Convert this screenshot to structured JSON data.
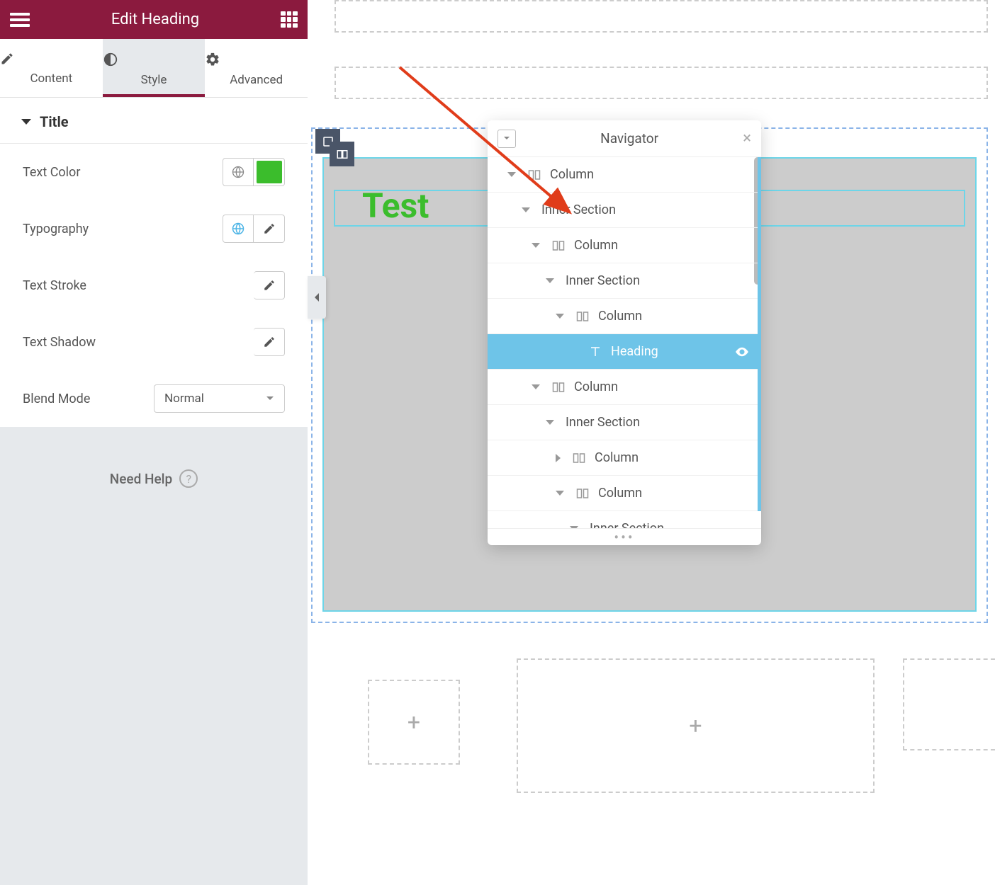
{
  "sidebar": {
    "title": "Edit Heading",
    "tabs": [
      {
        "label": "Content"
      },
      {
        "label": "Style"
      },
      {
        "label": "Advanced"
      }
    ],
    "section_title": "Title",
    "controls": {
      "text_color": "Text Color",
      "typography": "Typography",
      "text_stroke": "Text Stroke",
      "text_shadow": "Text Shadow",
      "blend_mode": "Blend Mode",
      "blend_mode_value": "Normal"
    },
    "text_color_value": "#3bbd2c",
    "help": "Need Help"
  },
  "canvas": {
    "heading_text": "Test"
  },
  "navigator": {
    "title": "Navigator",
    "items": [
      {
        "label": "Column",
        "indent": 28,
        "icon": "column",
        "caret": "down"
      },
      {
        "label": "Inner Section",
        "indent": 48,
        "icon": null,
        "caret": "down"
      },
      {
        "label": "Column",
        "indent": 62,
        "icon": "column",
        "caret": "down"
      },
      {
        "label": "Inner Section",
        "indent": 82,
        "icon": null,
        "caret": "down"
      },
      {
        "label": "Column",
        "indent": 96,
        "icon": "column",
        "caret": "down"
      },
      {
        "label": "Heading",
        "indent": 142,
        "icon": "heading",
        "caret": null,
        "selected": true
      },
      {
        "label": "Column",
        "indent": 62,
        "icon": "column",
        "caret": "down"
      },
      {
        "label": "Inner Section",
        "indent": 82,
        "icon": null,
        "caret": "down"
      },
      {
        "label": "Column",
        "indent": 96,
        "icon": "column",
        "caret": "right"
      },
      {
        "label": "Column",
        "indent": 96,
        "icon": "column",
        "caret": "down"
      },
      {
        "label": "Inner Section",
        "indent": 116,
        "icon": null,
        "caret": "down"
      }
    ]
  }
}
